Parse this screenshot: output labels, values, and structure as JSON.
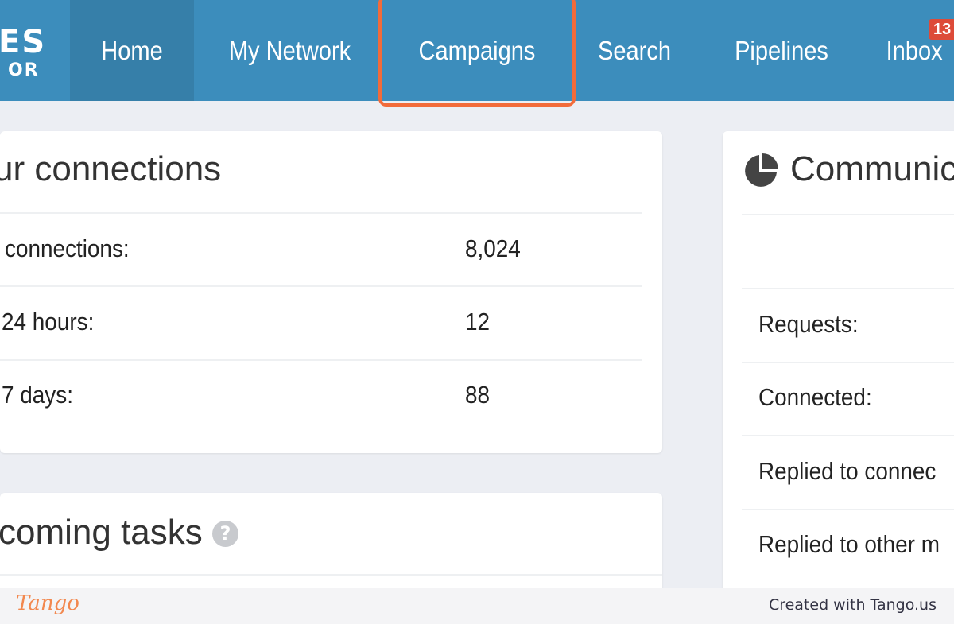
{
  "logo": {
    "line1": "ES",
    "line2": "OR"
  },
  "nav": {
    "home": "Home",
    "my_network": "My Network",
    "campaigns": "Campaigns",
    "search": "Search",
    "pipelines": "Pipelines",
    "inbox": "Inbox",
    "inbox_count": "13"
  },
  "connections": {
    "title": "ur connections",
    "rows": [
      {
        "label": "connections:",
        "value": "8,024"
      },
      {
        "label": "24 hours:",
        "value": "12"
      },
      {
        "label": "7 days:",
        "value": "88"
      }
    ]
  },
  "tasks": {
    "title": "coming tasks",
    "help": "?"
  },
  "communications": {
    "title": "Communic",
    "rows": [
      {
        "label": "Requests:"
      },
      {
        "label": "Connected:"
      },
      {
        "label": "Replied to connec"
      },
      {
        "label": "Replied to other m"
      }
    ]
  },
  "footer": {
    "logo": "Tango",
    "credit": "Created with Tango.us"
  },
  "colors": {
    "nav_bg": "#3c8dbc",
    "nav_active": "#367fa9",
    "highlight": "#f26b3a",
    "badge": "#dd4b39"
  }
}
